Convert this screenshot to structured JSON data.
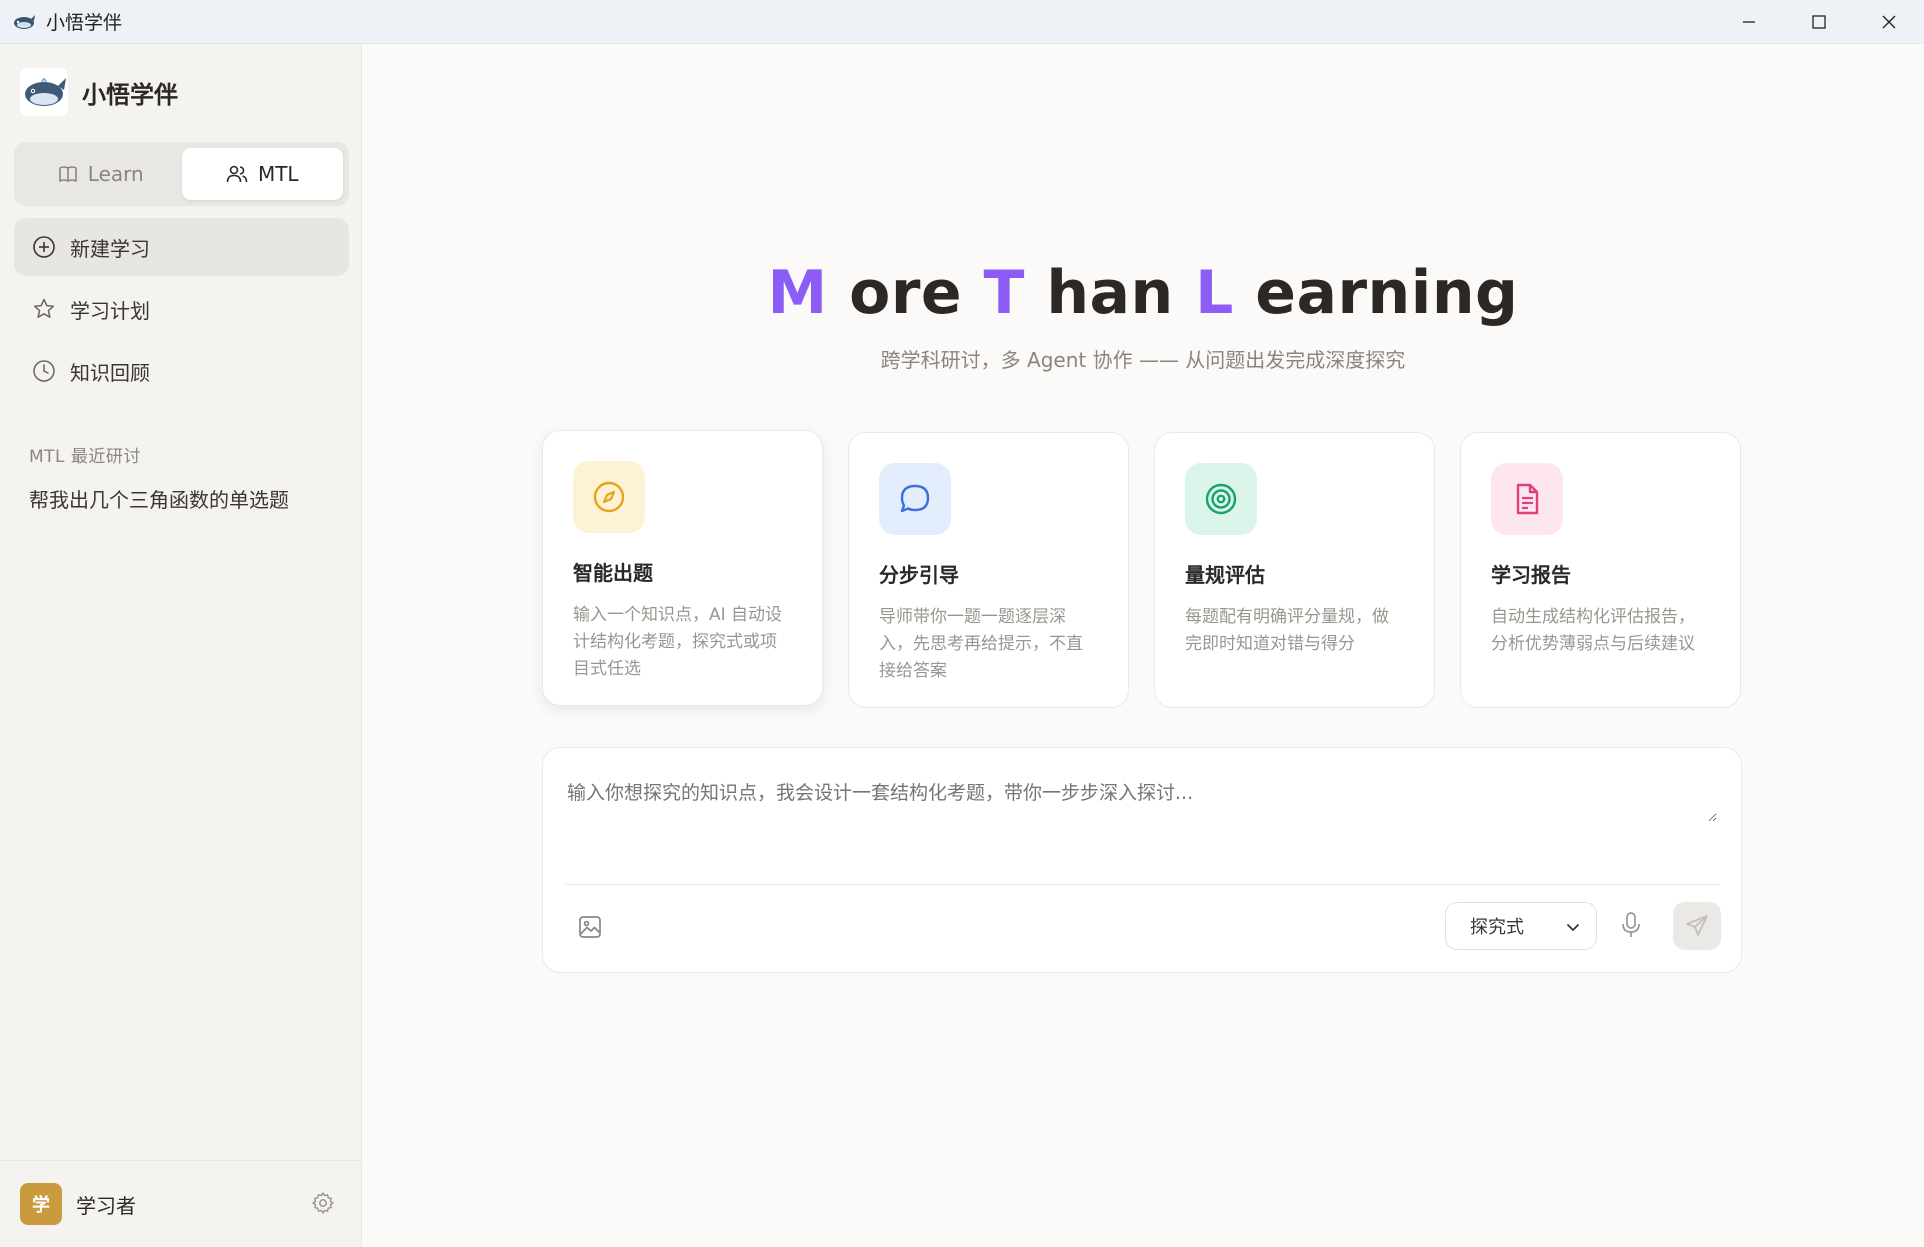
{
  "window": {
    "title": "小悟学伴",
    "minimize_icon": "minimize-icon",
    "maximize_icon": "maximize-icon",
    "close_icon": "close-icon"
  },
  "sidebar": {
    "brand_name": "小悟学伴",
    "tabs": [
      {
        "label": "Learn",
        "icon": "book-icon",
        "active": false
      },
      {
        "label": "MTL",
        "icon": "users-icon",
        "active": true
      }
    ],
    "nav": [
      {
        "label": "新建学习",
        "icon": "plus-circle-icon",
        "active": true
      },
      {
        "label": "学习计划",
        "icon": "star-icon",
        "active": false
      },
      {
        "label": "知识回顾",
        "icon": "clock-icon",
        "active": false
      }
    ],
    "recent_label": "MTL 最近研讨",
    "recent_items": [
      "帮我出几个三角函数的单选题"
    ],
    "user": {
      "avatar_text": "学",
      "name": "学习者",
      "avatar_color": "#c99a3e"
    }
  },
  "main": {
    "hero": {
      "part1_accent": "M",
      "part1_rest": " ore ",
      "part2_accent": "T",
      "part2_rest": " han ",
      "part3_accent": "L",
      "part3_rest": " earning",
      "accent_color": "#8b5cf6"
    },
    "subtitle": "跨学科研讨，多 Agent 协作 —— 从问题出发完成深度探究",
    "cards": [
      {
        "title": "智能出题",
        "desc": "输入一个知识点，AI 自动设计结构化考题，探究式或项目式任选",
        "icon": "compass-icon",
        "bg": "#fdf1d6",
        "color": "#e8a317"
      },
      {
        "title": "分步引导",
        "desc": "导师带你一题一题逐层深入，先思考再给提示，不直接给答案",
        "icon": "chat-bubble-icon",
        "bg": "#e4edfc",
        "color": "#3b6fe0"
      },
      {
        "title": "量规评估",
        "desc": "每题配有明确评分量规，做完即时知道对错与得分",
        "icon": "target-icon",
        "bg": "#dcf5ea",
        "color": "#16a36b"
      },
      {
        "title": "学习报告",
        "desc": "自动生成结构化评估报告，分析优势薄弱点与后续建议",
        "icon": "document-icon",
        "bg": "#fde6f0",
        "color": "#e0407a"
      }
    ],
    "composer": {
      "placeholder": "输入你想探究的知识点，我会设计一套结构化考题，带你一步步深入探讨...",
      "mode": "探究式",
      "image_icon": "image-icon",
      "mic_icon": "mic-icon",
      "send_icon": "send-icon"
    }
  }
}
